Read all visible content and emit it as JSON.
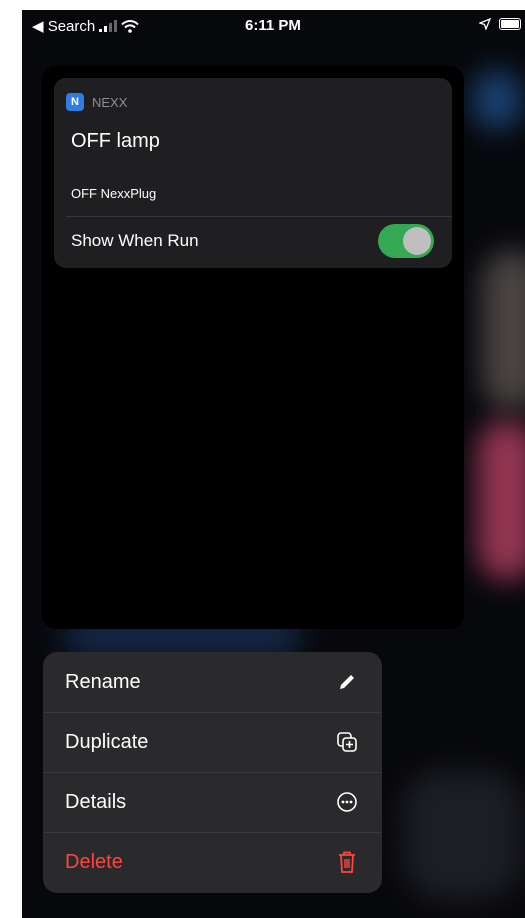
{
  "status_bar": {
    "back_label": "◀ Search",
    "time": "6:11 PM"
  },
  "shortcut": {
    "app_icon_letter": "N",
    "app_name": "NEXX",
    "title": "OFF lamp",
    "subtitle": "OFF NexxPlug",
    "show_when_run_label": "Show When Run",
    "show_when_run_enabled": true
  },
  "menu": {
    "rename": "Rename",
    "duplicate": "Duplicate",
    "details": "Details",
    "delete": "Delete"
  },
  "colors": {
    "accent_green": "#34a853",
    "destructive_red": "#ff453a",
    "app_blue": "#2f7de1"
  }
}
